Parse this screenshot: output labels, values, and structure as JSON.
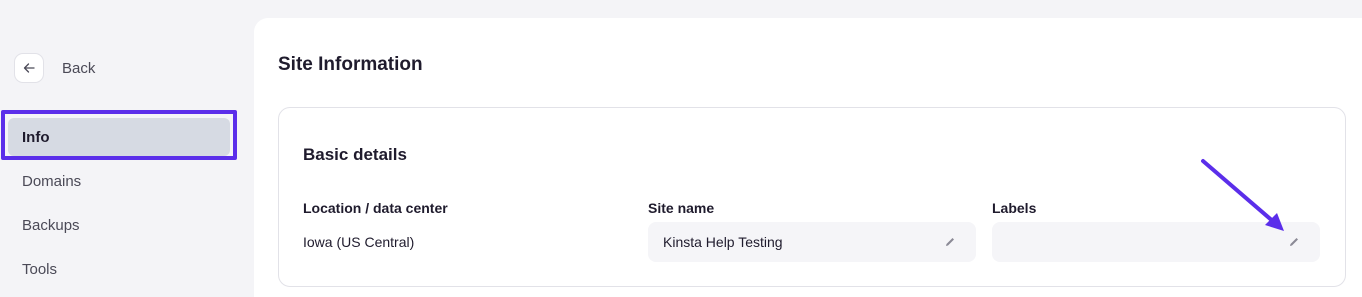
{
  "sidebar": {
    "back_label": "Back",
    "items": [
      {
        "label": "Info",
        "active": true
      },
      {
        "label": "Domains",
        "active": false
      },
      {
        "label": "Backups",
        "active": false
      },
      {
        "label": "Tools",
        "active": false
      }
    ]
  },
  "main": {
    "title": "Site Information",
    "card": {
      "title": "Basic details",
      "fields": [
        {
          "label": "Location / data center",
          "value": "Iowa (US Central)"
        },
        {
          "label": "Site name",
          "value": "Kinsta Help Testing"
        },
        {
          "label": "Labels",
          "value": ""
        }
      ]
    }
  },
  "colors": {
    "accent": "#5b2eea",
    "active_nav_bg": "#d6dae3",
    "field_bg": "#f5f5f8"
  },
  "icons": {
    "back": "arrow-left-icon",
    "edit": "pencil-icon",
    "annotation": "arrow-annotation-icon"
  }
}
